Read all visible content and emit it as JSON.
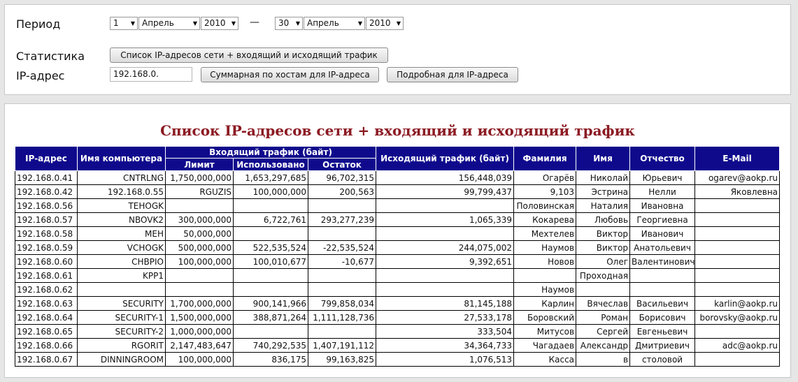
{
  "controls": {
    "period_label": "Период",
    "from": {
      "day": "1",
      "month": "Апрель",
      "year": "2010"
    },
    "separator": "—",
    "to": {
      "day": "30",
      "month": "Апрель",
      "year": "2010"
    },
    "stats_label": "Статистика",
    "stats_button": "Список IP-адресов сети  +  входящий и исходящий трафик",
    "ip_label": "IP-адрес",
    "ip_value": "192.168.0.",
    "host_summary_button": "Суммарная по хостам для IP-адреса",
    "detailed_button": "Подробная для IP-адреса"
  },
  "report": {
    "title": "Список IP-адресов сети + входящий и исходящий трафик",
    "headers": {
      "ip": "IP-адрес",
      "computer": "Имя компьютера",
      "incoming": "Входящий трафик (байт)",
      "limit": "Лимит",
      "used": "Использовано",
      "remaining": "Остаток",
      "outgoing": "Исходящий трафик (байт)",
      "surname": "Фамилия",
      "name": "Имя",
      "patronymic": "Отчество",
      "email": "E-Mail"
    },
    "rows": [
      [
        "192.168.0.41",
        "CNTRLNG",
        "1,750,000,000",
        "1,653,297,685",
        "96,702,315",
        "156,448,039",
        "Огарёв",
        "Николай",
        "Юрьевич",
        "ogarev@aokp.ru"
      ],
      [
        "192.168.0.42",
        "192.168.0.55",
        "RGUZIS",
        "100,000,000",
        "200,563",
        "99,799,437",
        "9,103",
        "Эстрина",
        "Нелли",
        "Яковлевна"
      ],
      [
        "192.168.0.56",
        "TEHOGK",
        "",
        "",
        "",
        "",
        "Половинская",
        "Наталия",
        "Ивановна",
        ""
      ],
      [
        "192.168.0.57",
        "NBOVK2",
        "300,000,000",
        "6,722,761",
        "293,277,239",
        "1,065,339",
        "Кокарева",
        "Любовь",
        "Георгиевна",
        ""
      ],
      [
        "192.168.0.58",
        "MEH",
        "50,000,000",
        "",
        "",
        "",
        "Мехтелев",
        "Виктор",
        "Иванович",
        ""
      ],
      [
        "192.168.0.59",
        "VCHOGK",
        "500,000,000",
        "522,535,524",
        "-22,535,524",
        "244,075,002",
        "Наумов",
        "Виктор",
        "Анатольевич",
        ""
      ],
      [
        "192.168.0.60",
        "CHBPIO",
        "100,000,000",
        "100,010,677",
        "-10,677",
        "9,392,651",
        "Новов",
        "Олег",
        "Валентинович",
        ""
      ],
      [
        "192.168.0.61",
        "KPP1",
        "",
        "",
        "",
        "",
        "",
        "Проходная",
        "",
        ""
      ],
      [
        "192.168.0.62",
        "",
        "",
        "",
        "",
        "",
        "Наумов",
        "",
        "",
        ""
      ],
      [
        "192.168.0.63",
        "SECURITY",
        "1,700,000,000",
        "900,141,966",
        "799,858,034",
        "81,145,188",
        "Карлин",
        "Вячеслав",
        "Васильевич",
        "karlin@aokp.ru"
      ],
      [
        "192.168.0.64",
        "SECURITY-1",
        "1,500,000,000",
        "388,871,264",
        "1,111,128,736",
        "27,533,178",
        "Боровский",
        "Роман",
        "Борисович",
        "borovsky@aokp.ru"
      ],
      [
        "192.168.0.65",
        "SECURITY-2",
        "1,000,000,000",
        "",
        "",
        "333,504",
        "Митусов",
        "Сергей",
        "Евгеньевич",
        ""
      ],
      [
        "192.168.0.66",
        "RGORIT",
        "2,147,483,647",
        "740,292,535",
        "1,407,191,112",
        "34,364,733",
        "Чагадаев",
        "Александр",
        "Дмитриевич",
        "adc@aokp.ru"
      ],
      [
        "192.168.0.67",
        "DINNINGROOM",
        "100,000,000",
        "836,175",
        "99,163,825",
        "1,076,513",
        "Касса",
        "в",
        "столовой",
        ""
      ]
    ]
  }
}
